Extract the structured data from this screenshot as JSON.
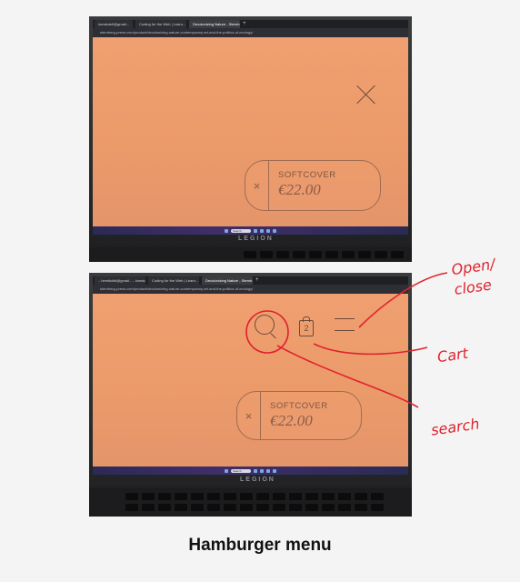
{
  "photo1": {
    "tabs": [
      "lomstuts9@gmail...",
      "Coding for the Web | Learn...",
      "Decolonizing Nature - Sternb..."
    ],
    "tab_plus": "+",
    "address": "sternberg-press.com/product/decolonizing-nature-contemporary-art-and-the-politics-of-ecology/",
    "card": {
      "format": "SOFTCOVER",
      "price": "€22.00",
      "close_glyph": "×"
    },
    "taskbar_search": "Search",
    "laptop_logo": "LEGION"
  },
  "photo2": {
    "tabs": [
      "...hemitutkil@gmail... - lomstuts@gmail...",
      "Coding for the Web | Learn...",
      "Decolonizing Nature - Sternb..."
    ],
    "tab_plus": "+",
    "address": "sternberg-press.com/product/decolonizing-nature-contemporary-art-and-the-politics-of-ecology/",
    "cart_count": "2",
    "card": {
      "format": "SOFTCOVER",
      "price": "€22.00",
      "close_glyph": "×"
    },
    "taskbar_search": "Search",
    "laptop_logo": "LEGION"
  },
  "annotations": {
    "open_close": "Open/ close",
    "cart": "Cart",
    "search": "search"
  },
  "caption": "Hamburger menu",
  "colors": {
    "annotation_red": "#e0222e",
    "page_peach": "#eb9a6a",
    "background": "#f4f4f4"
  }
}
